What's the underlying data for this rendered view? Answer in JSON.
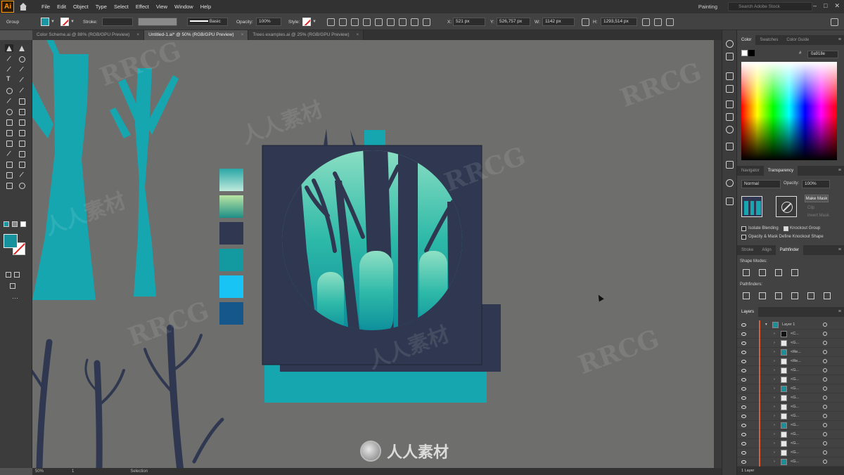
{
  "app": {
    "logo": "Ai",
    "workspace": "Painting",
    "search_placeholder": "Search Adobe Stock"
  },
  "menu": [
    "File",
    "Edit",
    "Object",
    "Type",
    "Select",
    "Effect",
    "View",
    "Window",
    "Help"
  ],
  "control_bar": {
    "selection": "Group",
    "stroke_label": "Stroke:",
    "brush": "Basic",
    "opacity_label": "Opacity:",
    "opacity": "100%",
    "style_label": "Style:",
    "x_label": "X:",
    "x": "521 px",
    "y_label": "Y:",
    "y": "526,757 px",
    "w_label": "W:",
    "w": "1142 px",
    "h_label": "H:",
    "h": "1293,514 px"
  },
  "tabs": [
    {
      "label": "Color Scheme.ai @ 88% (RGB/GPU Preview)",
      "active": false
    },
    {
      "label": "Untitled-1.ai* @ 50% (RGB/GPU Preview)",
      "active": true
    },
    {
      "label": "Trees examples.ai @ 25% (RGB/GPU Preview)",
      "active": false
    }
  ],
  "color_panel": {
    "tabs": [
      "Color",
      "Swatches",
      "Color Guide"
    ],
    "hex": "0a918e"
  },
  "transparency_panel": {
    "tabs": [
      "Navigator",
      "Transparency"
    ],
    "blend_mode": "Normal",
    "opacity_label": "Opacity:",
    "opacity": "100%",
    "make_mask": "Make Mask",
    "clip": "Clip",
    "invert_mask": "Invert Mask",
    "isolate_blending": "Isolate Blending",
    "knockout_group": "Knockout Group",
    "opacity_mask_define": "Opacity & Mask Define Knockout Shape"
  },
  "pathfinder_panel": {
    "tabs": [
      "Stroke",
      "Align",
      "Pathfinder"
    ],
    "shape_modes": "Shape Modes:",
    "pathfinders": "Pathfinders:"
  },
  "layers_panel": {
    "title": "Layers",
    "layer_name": "Layer 1",
    "rows": [
      "<C...",
      "<G...",
      "<Re...",
      "<Re...",
      "<G...",
      "<G...",
      "<G...",
      "<G...",
      "<G...",
      "<G...",
      "<G...",
      "<G...",
      "<G...",
      "<G...",
      "<G...",
      "<G...",
      "<Re..."
    ],
    "footer": "1 Layer"
  },
  "status_bar": {
    "zoom": "50%",
    "artboard": "1",
    "mode": "Selection"
  },
  "palette_colors": [
    "#3fb3ad",
    "#7fc79a",
    "#2f3850",
    "#139aa0",
    "#18c4f3",
    "#15578b"
  ],
  "colors": {
    "teal": "#16a6b0",
    "navy": "#2f3850",
    "canvas": "#6e6f6c"
  },
  "watermark": {
    "text": "RRCG",
    "cn": "人人素材"
  }
}
